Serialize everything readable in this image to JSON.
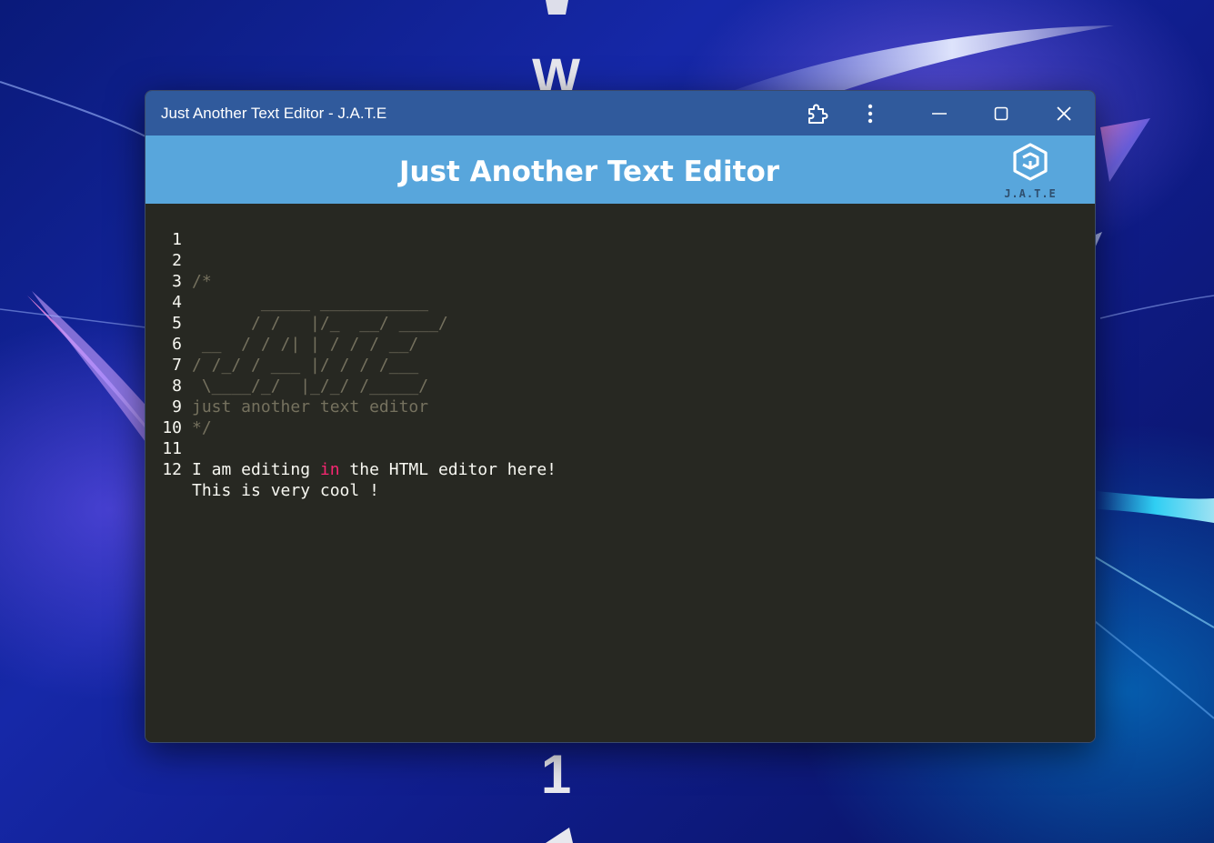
{
  "wallpaper": {
    "letters": [
      "W",
      "1"
    ]
  },
  "window": {
    "title": "Just Another Text Editor - J.A.T.E",
    "controls": {
      "extensions_icon": "puzzle-icon",
      "menu_icon": "more-vertical-icon",
      "minimize_icon": "minimize-icon",
      "maximize_icon": "maximize-icon",
      "close_icon": "close-icon"
    }
  },
  "app": {
    "header_title": "Just Another Text Editor",
    "logo_text": "J.A.T.E"
  },
  "editor": {
    "lines": [
      {
        "num": "1",
        "text": ""
      },
      {
        "num": "2",
        "text": "/*"
      },
      {
        "num": "3",
        "text": "       _____ ___________"
      },
      {
        "num": "4",
        "text": "      / /   |/_  __/ ____/"
      },
      {
        "num": "5",
        "text": " __  / / /| | / / / __/"
      },
      {
        "num": "6",
        "text": "/ /_/ / ___ |/ / / /___"
      },
      {
        "num": "7",
        "text": " \\____/_/  |_/_/ /_____/"
      },
      {
        "num": "8",
        "text": "just another text editor"
      },
      {
        "num": "9",
        "text": "*/"
      },
      {
        "num": "10",
        "text": ""
      },
      {
        "num": "11",
        "pre": "I am editing ",
        "kw": "in",
        "post": " the HTML editor here!"
      },
      {
        "num": "12",
        "text": "This is very cool !"
      }
    ]
  },
  "colors": {
    "titlebar": "#305a9c",
    "header": "#58a6dc",
    "editor_bg": "#272822",
    "comment": "#75715e",
    "keyword": "#f92672",
    "text": "#f8f8f2"
  }
}
